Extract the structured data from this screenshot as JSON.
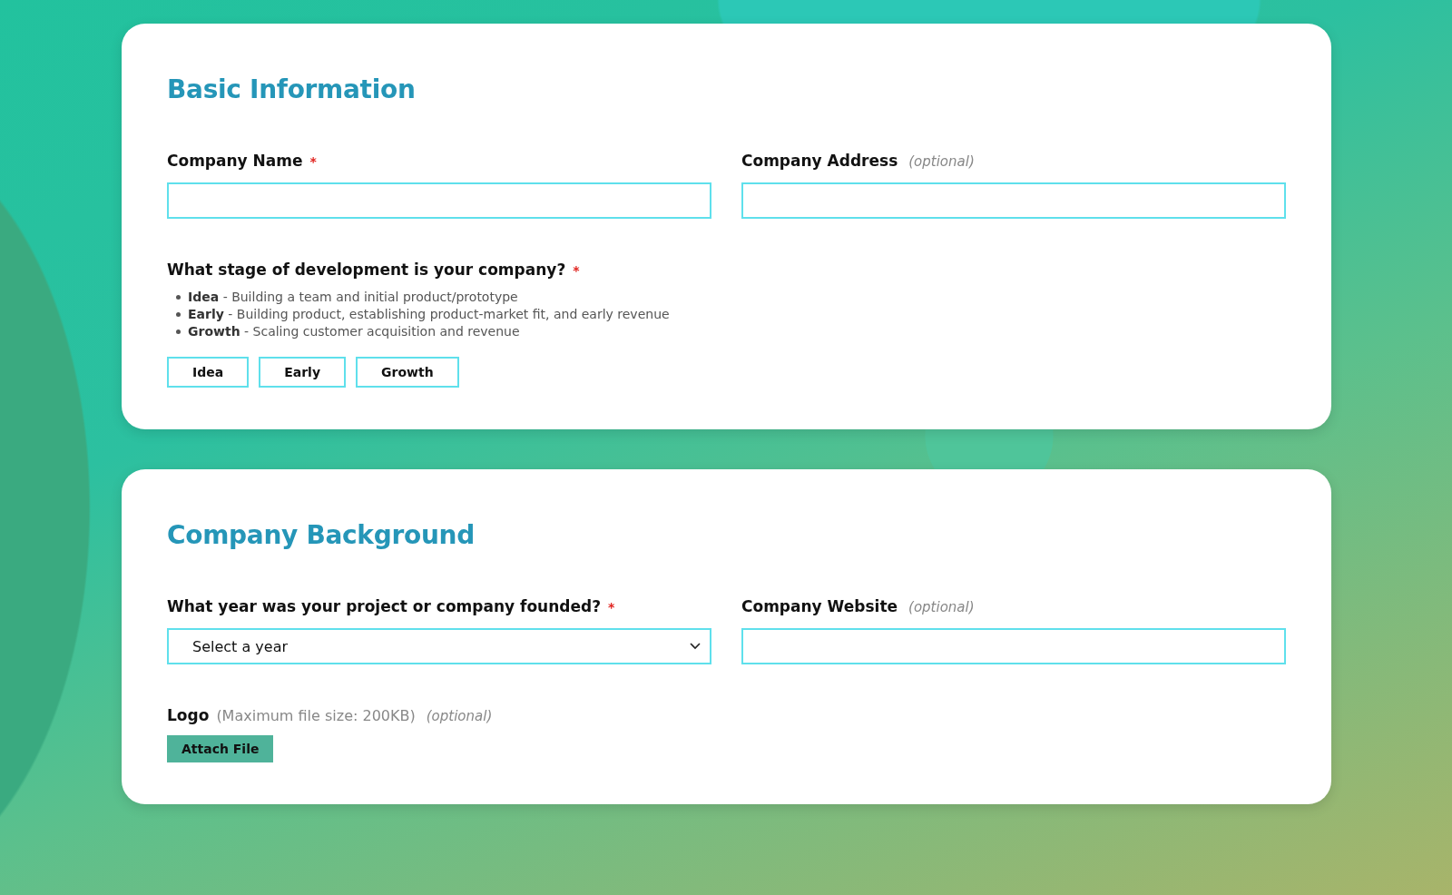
{
  "sections": [
    {
      "title": "Basic Information",
      "fields": [
        {
          "kind": "text",
          "label": "Company Name",
          "required_mark": "*"
        },
        {
          "kind": "text",
          "label": "Company Address",
          "note": "(optional)"
        },
        {
          "kind": "choice",
          "label": "What stage of development is your company?",
          "required_mark": "*",
          "bullets": [
            "**Idea** - Building a team and initial product/prototype",
            "**Early** - Building product, establishing product-market fit, and early revenue",
            "**Growth** - Scaling customer acquisition and revenue"
          ],
          "options": [
            {
              "label": "Idea",
              "selected": false
            },
            {
              "label": "Early",
              "selected": false
            },
            {
              "label": "Growth",
              "selected": false
            }
          ]
        }
      ]
    },
    {
      "title": "Company Background",
      "fields": [
        {
          "kind": "select",
          "label": "What year was your project or company founded?",
          "required_mark": "*",
          "value": "Select a year"
        },
        {
          "kind": "text",
          "label": "Company Website",
          "note": "(optional)"
        },
        {
          "kind": "file",
          "label": "Logo",
          "hint": "(Maximum file size: 200KB)",
          "note": "(optional)",
          "button": "Attach File"
        }
      ]
    }
  ]
}
